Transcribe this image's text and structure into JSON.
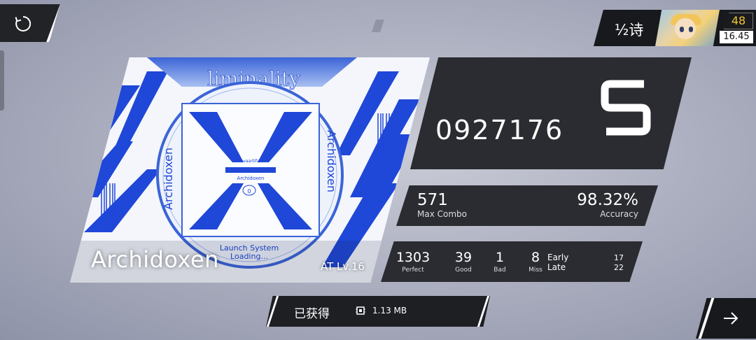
{
  "player": {
    "name": "½诗",
    "level": "48",
    "rks": "16.45"
  },
  "song": {
    "title": "Archidoxen",
    "difficulty": "AT Lv.16",
    "art": {
      "logo": "liminality",
      "side_text": "Archidoxen",
      "center_small": "novaartifact",
      "center_title": "Archidoxen",
      "center_mark": "0",
      "launch_line1": "Launch System",
      "launch_line2": "Loading..."
    }
  },
  "result": {
    "score": "0927176",
    "grade": "S",
    "max_combo": "571",
    "max_combo_label": "Max Combo",
    "accuracy": "98.32%",
    "accuracy_label": "Accuracy",
    "judgements": [
      {
        "value": "1303",
        "label": "Perfect"
      },
      {
        "value": "39",
        "label": "Good"
      },
      {
        "value": "1",
        "label": "Bad"
      },
      {
        "value": "8",
        "label": "Miss"
      }
    ],
    "early_label": "Early",
    "late_label": "Late",
    "early": "17",
    "late": "22"
  },
  "reward": {
    "label": "已获得",
    "size": "1.13 MB",
    "icon": "data-chip-icon"
  },
  "icons": {
    "restart": "restart-icon",
    "next": "arrow-right-icon"
  },
  "colors": {
    "panel": "#2b2c31",
    "accent_blue": "#1a3fd6",
    "level_gold": "#f2c733"
  }
}
